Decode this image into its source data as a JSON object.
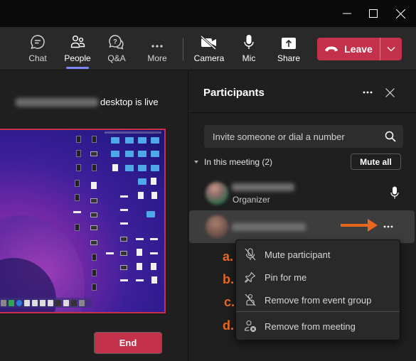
{
  "window": {
    "controls": [
      "minimize",
      "maximize",
      "close"
    ]
  },
  "toolbar": {
    "items": [
      {
        "label": "Chat",
        "icon": "chat-icon"
      },
      {
        "label": "People",
        "icon": "people-icon",
        "active": true
      },
      {
        "label": "Q&A",
        "icon": "qa-icon"
      },
      {
        "label": "More",
        "icon": "more-icon"
      },
      {
        "label": "Camera",
        "icon": "camera-off-icon"
      },
      {
        "label": "Mic",
        "icon": "mic-icon"
      },
      {
        "label": "Share",
        "icon": "share-icon"
      }
    ],
    "leave_label": "Leave",
    "active_indicator_color": "#7f85f5",
    "leave_color": "#c4314b"
  },
  "stage": {
    "presenter_name": "Smith, Stephanie",
    "live_suffix": "desktop is live",
    "end_label": "End",
    "share_border_color": "#c4314b"
  },
  "participants_panel": {
    "title": "Participants",
    "invite_placeholder": "Invite someone or dial a number",
    "section_label": "In this meeting (2)",
    "mute_all_label": "Mute all",
    "participants": [
      {
        "name": "Flores, Renata",
        "role": "Organizer",
        "mic": "on"
      },
      {
        "name": "Smith, Stephanie",
        "role": "",
        "selected": true
      }
    ]
  },
  "context_menu": {
    "items": [
      {
        "marker": "a.",
        "label": "Mute participant",
        "icon": "mic-off-icon"
      },
      {
        "marker": "b.",
        "label": "Pin for me",
        "icon": "pin-icon"
      },
      {
        "marker": "c.",
        "label": "Remove from event group",
        "icon": "remove-group-icon"
      },
      {
        "marker": "d.",
        "label": "Remove from meeting",
        "icon": "remove-person-icon"
      }
    ],
    "marker_color": "#e8671f"
  }
}
